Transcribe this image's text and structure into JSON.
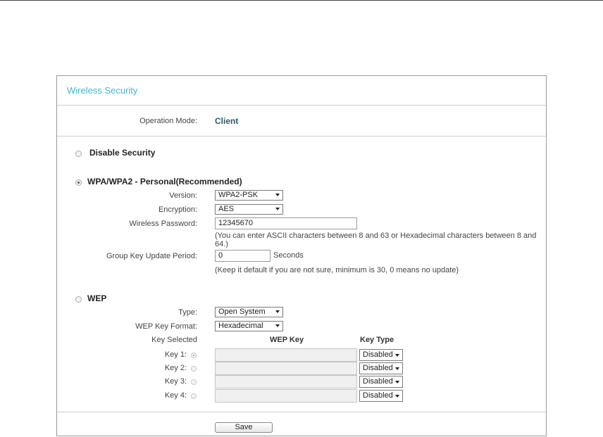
{
  "panel": {
    "title": "Wireless Security"
  },
  "operation_mode": {
    "label": "Operation Mode:",
    "value": "Client"
  },
  "disable_security": {
    "label": "Disable Security",
    "selected": false
  },
  "wpa": {
    "title": "WPA/WPA2 - Personal(Recommended)",
    "selected": true,
    "version": {
      "label": "Version:",
      "value": "WPA2-PSK"
    },
    "encryption": {
      "label": "Encryption:",
      "value": "AES"
    },
    "password": {
      "label": "Wireless Password:",
      "value": "12345670",
      "note": "(You can enter ASCII characters between 8 and 63 or Hexadecimal characters between 8 and 64.)"
    },
    "group_key": {
      "label": "Group Key Update Period:",
      "value": "0",
      "unit": "Seconds",
      "note": "(Keep it default if you are not sure, minimum is 30, 0 means no update)"
    }
  },
  "wep": {
    "title": "WEP",
    "selected": false,
    "type": {
      "label": "Type:",
      "value": "Open System"
    },
    "key_format": {
      "label": "WEP Key Format:",
      "value": "Hexadecimal"
    },
    "headers": {
      "key_selected": "Key Selected",
      "wep_key": "WEP Key",
      "key_type": "Key Type"
    },
    "keys": [
      {
        "label": "Key 1:",
        "value": "",
        "type": "Disabled",
        "selected": true
      },
      {
        "label": "Key 2:",
        "value": "",
        "type": "Disabled",
        "selected": false
      },
      {
        "label": "Key 3:",
        "value": "",
        "type": "Disabled",
        "selected": false
      },
      {
        "label": "Key 4:",
        "value": "",
        "type": "Disabled",
        "selected": false
      }
    ]
  },
  "save": {
    "label": "Save"
  },
  "colors": {
    "title_accent": "#3fb8d0",
    "value_text": "#2a5a6a"
  }
}
